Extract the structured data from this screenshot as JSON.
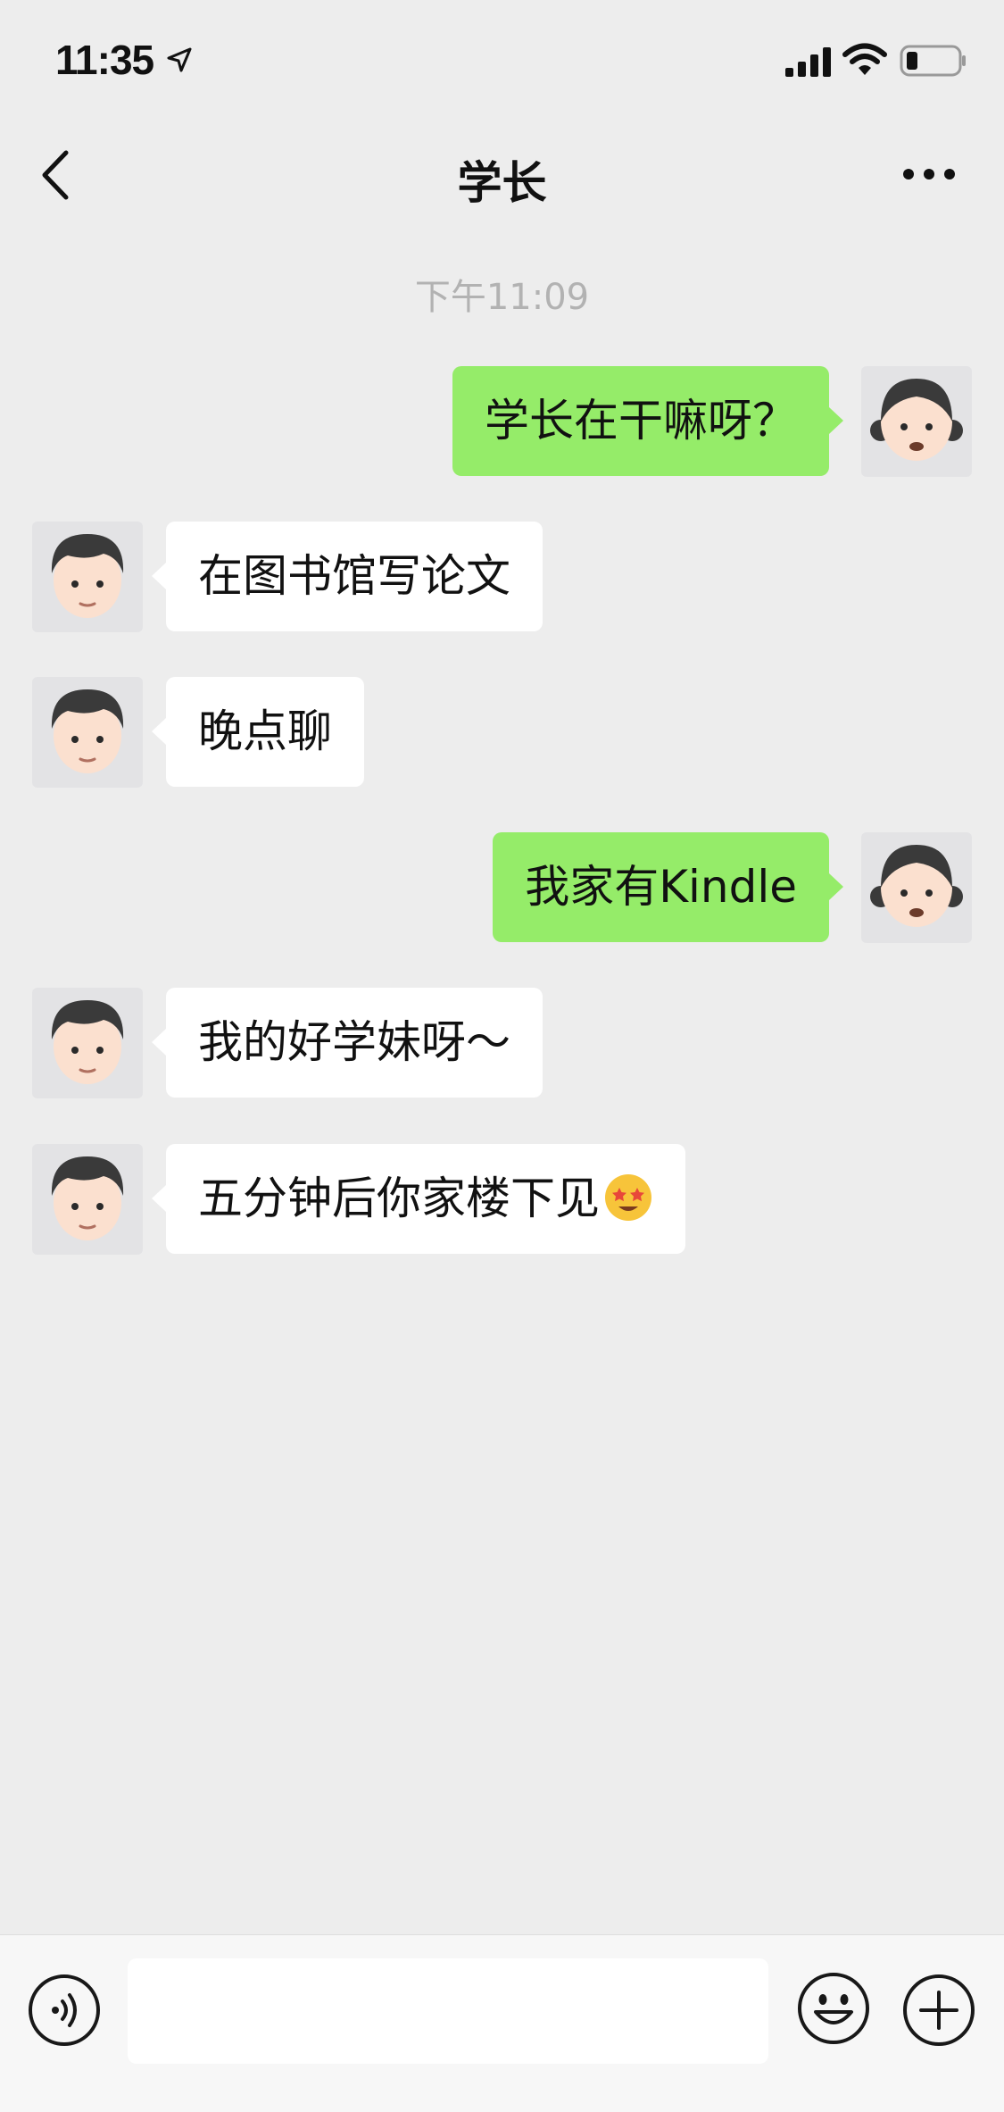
{
  "status_bar": {
    "time": "11:35",
    "icons": [
      "location-arrow-icon",
      "signal-icon",
      "wifi-icon",
      "battery-icon"
    ]
  },
  "nav": {
    "title": "学长",
    "back_icon": "chevron-left-icon",
    "more_icon": "more-dots-icon"
  },
  "chat": {
    "timestamp": "下午11:09",
    "messages": [
      {
        "from": "me",
        "text": "学长在干嘛呀？",
        "avatar": "girl-avatar"
      },
      {
        "from": "other",
        "text": "在图书馆写论文",
        "avatar": "boy-avatar"
      },
      {
        "from": "other",
        "text": "晚点聊",
        "avatar": "boy-avatar"
      },
      {
        "from": "me",
        "text": "我家有Kindle",
        "avatar": "girl-avatar"
      },
      {
        "from": "other",
        "text": "我的好学妹呀～",
        "avatar": "boy-avatar"
      },
      {
        "from": "other",
        "text": "五分钟后你家楼下见",
        "emoji": "star-struck-emoji",
        "avatar": "boy-avatar"
      }
    ]
  },
  "input_bar": {
    "value": "",
    "icons": [
      "voice-icon",
      "emoji-icon",
      "plus-icon"
    ]
  },
  "colors": {
    "background": "#ededed",
    "sent_bubble": "#95ec69",
    "received_bubble": "#ffffff",
    "timestamp": "#b2b2b2"
  }
}
